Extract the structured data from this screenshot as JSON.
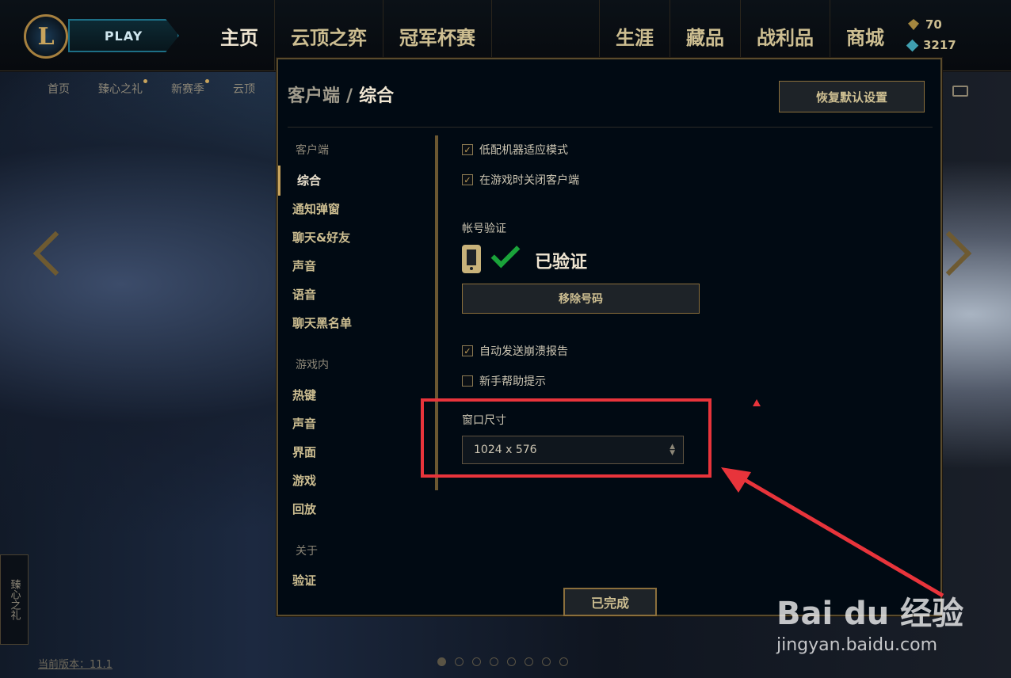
{
  "topbar": {
    "logo_text": "L",
    "play_label": "PLAY",
    "nav_left": [
      "主页",
      "云顶之弈",
      "冠军杯赛"
    ],
    "nav_right": [
      "生涯",
      "藏品",
      "战利品",
      "商城"
    ],
    "currency": {
      "rp_value": "70",
      "be_value": "3217"
    }
  },
  "background": {
    "subnav": [
      "首页",
      "臻心之礼",
      "新赛季",
      "云顶"
    ],
    "side_gift": "臻心之礼",
    "version": "当前版本：11.1"
  },
  "modal": {
    "breadcrumb_root": "客户端",
    "breadcrumb_sep": "/",
    "breadcrumb_current": "综合",
    "reset_label": "恢复默认设置",
    "menu": {
      "group_client": "客户端",
      "client_items": [
        "综合",
        "通知弹窗",
        "聊天&好友",
        "声音",
        "语音",
        "聊天黑名单"
      ],
      "group_ingame": "游戏内",
      "ingame_items": [
        "热键",
        "声音",
        "界面",
        "游戏",
        "回放"
      ],
      "group_about": "关于",
      "about_items": [
        "验证"
      ]
    },
    "options": {
      "low_spec": {
        "label": "低配机器适应模式",
        "checked": true
      },
      "close_in_game": {
        "label": "在游戏时关闭客户端",
        "checked": true
      },
      "account_label": "帐号验证",
      "verified_text": "已验证",
      "remove_phone_label": "移除号码",
      "crash_report": {
        "label": "自动发送崩溃报告",
        "checked": true
      },
      "tips": {
        "label": "新手帮助提示",
        "checked": false
      },
      "window_size_label": "窗口尺寸",
      "window_size_value": "1024 x 576"
    },
    "done_label": "已完成"
  },
  "pager": {
    "pages": 8,
    "current": 1
  },
  "annotation": {
    "color": "#e8343b"
  },
  "watermark": {
    "brand": "Bai du 经验",
    "url": "jingyan.baidu.com"
  }
}
